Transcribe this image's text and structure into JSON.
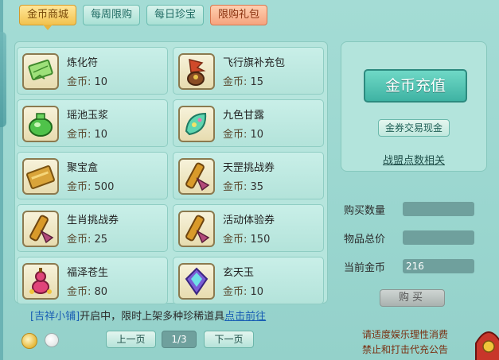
{
  "tabs": [
    {
      "label": "金币商城",
      "active": true
    },
    {
      "label": "每周限购",
      "active": false
    },
    {
      "label": "每日珍宝",
      "active": false
    },
    {
      "label": "限购礼包",
      "active": false
    }
  ],
  "items": [
    {
      "name": "炼化符",
      "price_label": "金币:",
      "price": "10",
      "icon": "talisman-icon"
    },
    {
      "name": "飞行旗补充包",
      "price_label": "金币:",
      "price": "15",
      "icon": "flag-bag-icon"
    },
    {
      "name": "瑶池玉浆",
      "price_label": "金币:",
      "price": "10",
      "icon": "jade-pot-icon"
    },
    {
      "name": "九色甘露",
      "price_label": "金币:",
      "price": "10",
      "icon": "dew-leaf-icon"
    },
    {
      "name": "聚宝盒",
      "price_label": "金币:",
      "price": "500",
      "icon": "treasure-box-icon"
    },
    {
      "name": "天罡挑战券",
      "price_label": "金币:",
      "price": "35",
      "icon": "scroll-icon"
    },
    {
      "name": "生肖挑战券",
      "price_label": "金币:",
      "price": "25",
      "icon": "scroll-icon"
    },
    {
      "name": "活动体验券",
      "price_label": "金币:",
      "price": "150",
      "icon": "scroll-icon"
    },
    {
      "name": "福泽苍生",
      "price_label": "金币:",
      "price": "80",
      "icon": "gourd-icon"
    },
    {
      "name": "玄天玉",
      "price_label": "金币:",
      "price": "10",
      "icon": "jade-gem-icon"
    }
  ],
  "right": {
    "recharge_label": "金币充值",
    "exchange_label": "金券交易现金",
    "alliance_label": "战盟点数相关",
    "buy_qty_label": "购买数量",
    "total_label": "物品总价",
    "current_label": "当前金币",
    "buy_qty_value": "",
    "total_value": "",
    "current_value": "216",
    "buy_label": "购买"
  },
  "notice": {
    "shop_name": "[吉祥小铺]",
    "text": "开启中，限时上架多种珍稀道具",
    "link": "点击前往"
  },
  "pager": {
    "prev": "上一页",
    "page": "1/3",
    "next": "下一页"
  },
  "tips": {
    "line1": "请适度娱乐理性消费",
    "line2": "禁止和打击代充公告"
  }
}
